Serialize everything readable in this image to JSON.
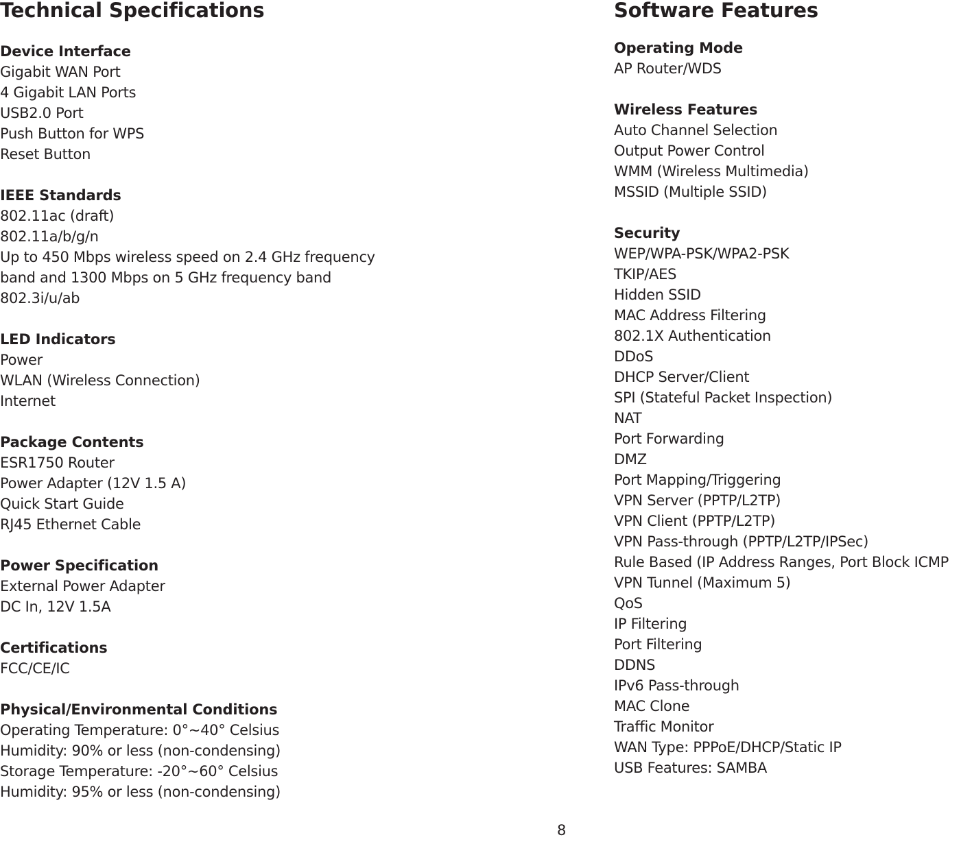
{
  "left": {
    "title": "Technical Specifications",
    "sections": [
      {
        "heading": "Device Interface",
        "items": [
          "Gigabit WAN Port",
          "4 Gigabit LAN Ports",
          "USB2.0 Port",
          "Push Button for WPS",
          "Reset Button"
        ]
      },
      {
        "heading": "IEEE Standards",
        "items": [
          "802.11ac (draft)",
          "802.11a/b/g/n",
          "Up to 450 Mbps wireless speed on 2.4 GHz frequency",
          "band and 1300 Mbps on 5 GHz frequency band",
          "802.3i/u/ab"
        ]
      },
      {
        "heading": "LED Indicators",
        "items": [
          "Power",
          "WLAN (Wireless Connection)",
          "Internet"
        ]
      },
      {
        "heading": "Package Contents",
        "items": [
          "ESR1750 Router",
          "Power Adapter (12V 1.5 A)",
          "Quick Start Guide",
          "RJ45 Ethernet Cable"
        ]
      },
      {
        "heading": "Power Specification",
        "items": [
          "External Power Adapter",
          "DC In, 12V 1.5A"
        ]
      },
      {
        "heading": "Certifications",
        "items": [
          "FCC/CE/IC"
        ]
      },
      {
        "heading": "Physical/Environmental Conditions",
        "items": [
          "Operating Temperature: 0°~40° Celsius",
          "Humidity: 90% or less (non-condensing)",
          "Storage Temperature: -20°~60° Celsius",
          "Humidity: 95% or less (non-condensing)"
        ]
      }
    ]
  },
  "right": {
    "title": "Software Features",
    "sections": [
      {
        "heading": "Operating Mode",
        "items": [
          "AP Router/WDS"
        ]
      },
      {
        "heading": "Wireless Features",
        "items": [
          "Auto Channel Selection",
          "Output Power Control",
          "WMM (Wireless Multimedia)",
          "MSSID (Multiple SSID)"
        ]
      },
      {
        "heading": "Security",
        "items": [
          "WEP/WPA-PSK/WPA2-PSK",
          "TKIP/AES",
          "Hidden SSID",
          "MAC Address Filtering",
          "802.1X Authentication",
          "DDoS",
          "DHCP Server/Client",
          "SPI (Stateful Packet Inspection)",
          "NAT",
          "Port Forwarding",
          "DMZ",
          "Port Mapping/Triggering",
          "VPN Server (PPTP/L2TP)",
          "VPN Client (PPTP/L2TP)",
          "VPN Pass-through (PPTP/L2TP/IPSec)",
          "Rule Based (IP Address Ranges, Port Block ICMP",
          "VPN Tunnel (Maximum 5)",
          "QoS",
          "IP Filtering",
          "Port Filtering",
          "DDNS",
          "IPv6 Pass-through",
          "MAC Clone",
          "Traffic Monitor",
          "WAN Type: PPPoE/DHCP/Static IP",
          "USB Features: SAMBA"
        ]
      }
    ]
  },
  "footer": {
    "page_number": "8"
  }
}
